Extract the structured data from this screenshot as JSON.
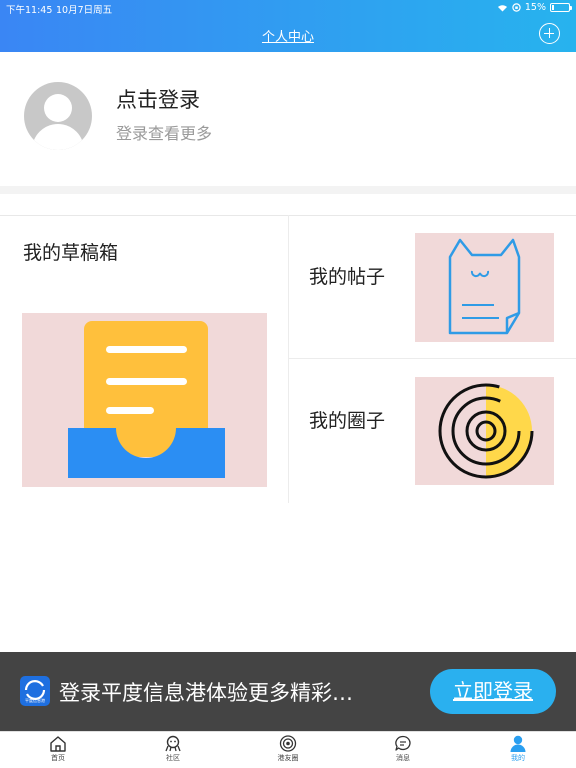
{
  "status_bar": {
    "time": "下午11:45",
    "date": "10月7日周五",
    "battery": "15%",
    "battery_level": 0.15
  },
  "nav": {
    "title": "个人中心"
  },
  "profile": {
    "title": "点击登录",
    "subtitle": "登录查看更多"
  },
  "cards": {
    "drafts": "我的草稿箱",
    "posts": "我的帖子",
    "circles": "我的圈子"
  },
  "banner": {
    "logo_text": "平度信息港",
    "text": "登录平度信息港体验更多精彩…",
    "button": "立即登录"
  },
  "tabs": [
    {
      "label": "首页",
      "icon": "home-icon"
    },
    {
      "label": "社区",
      "icon": "community-icon"
    },
    {
      "label": "港友圈",
      "icon": "friends-circle-icon"
    },
    {
      "label": "消息",
      "icon": "message-icon"
    },
    {
      "label": "我的",
      "icon": "person-icon"
    }
  ],
  "colors": {
    "accent": "#2a9ff0",
    "header_start": "#3a86f4",
    "header_end": "#27b3ee",
    "card_bg": "#f1d9d9"
  }
}
